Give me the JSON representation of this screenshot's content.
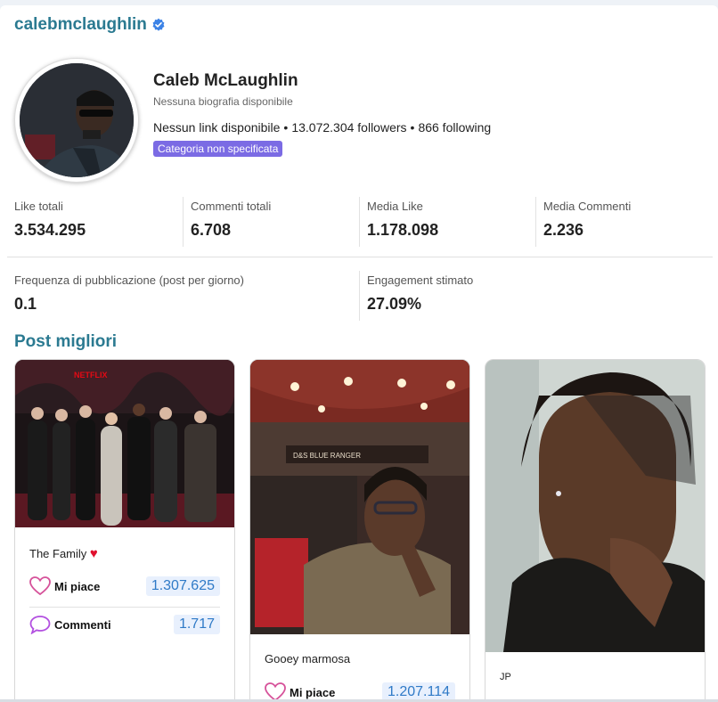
{
  "profile": {
    "handle": "calebmclaughlin",
    "name": "Caleb McLaughlin",
    "bio": "Nessuna biografia disponibile",
    "link": "Nessun link disponibile",
    "followers": "13.072.304 followers",
    "following": "866 following",
    "category": "Categoria non specificata"
  },
  "metrics": [
    {
      "label": "Like totali",
      "value": "3.534.295"
    },
    {
      "label": "Commenti totali",
      "value": "6.708"
    },
    {
      "label": "Media Like",
      "value": "1.178.098"
    },
    {
      "label": "Media Commenti",
      "value": "2.236"
    }
  ],
  "metrics2": [
    {
      "label": "Frequenza di pubblicazione (post per giorno)",
      "value": "0.1"
    },
    {
      "label": "Engagement stimato",
      "value": "27.09%"
    }
  ],
  "section_title": "Post migliori",
  "posts": [
    {
      "caption": "The Family",
      "caption_emoji": "❤️",
      "likes_label": "Mi piace",
      "likes": "1.307.625",
      "comments_label": "Commenti",
      "comments": "1.717"
    },
    {
      "caption": "Gooey marmosa",
      "likes_label": "Mi piace",
      "likes": "1.207.114"
    },
    {
      "caption": "JP"
    }
  ],
  "colors": {
    "accent": "#2b7a91",
    "badge": "#7b6be4",
    "heart": "#d6529a",
    "comment": "#b24fe0",
    "pill_bg": "#e8f0fd",
    "pill_text": "#2f7ac7"
  },
  "icons": {
    "verified": "verified-badge-icon",
    "likes": "heart-outline-icon",
    "comments": "speech-bubble-icon"
  }
}
